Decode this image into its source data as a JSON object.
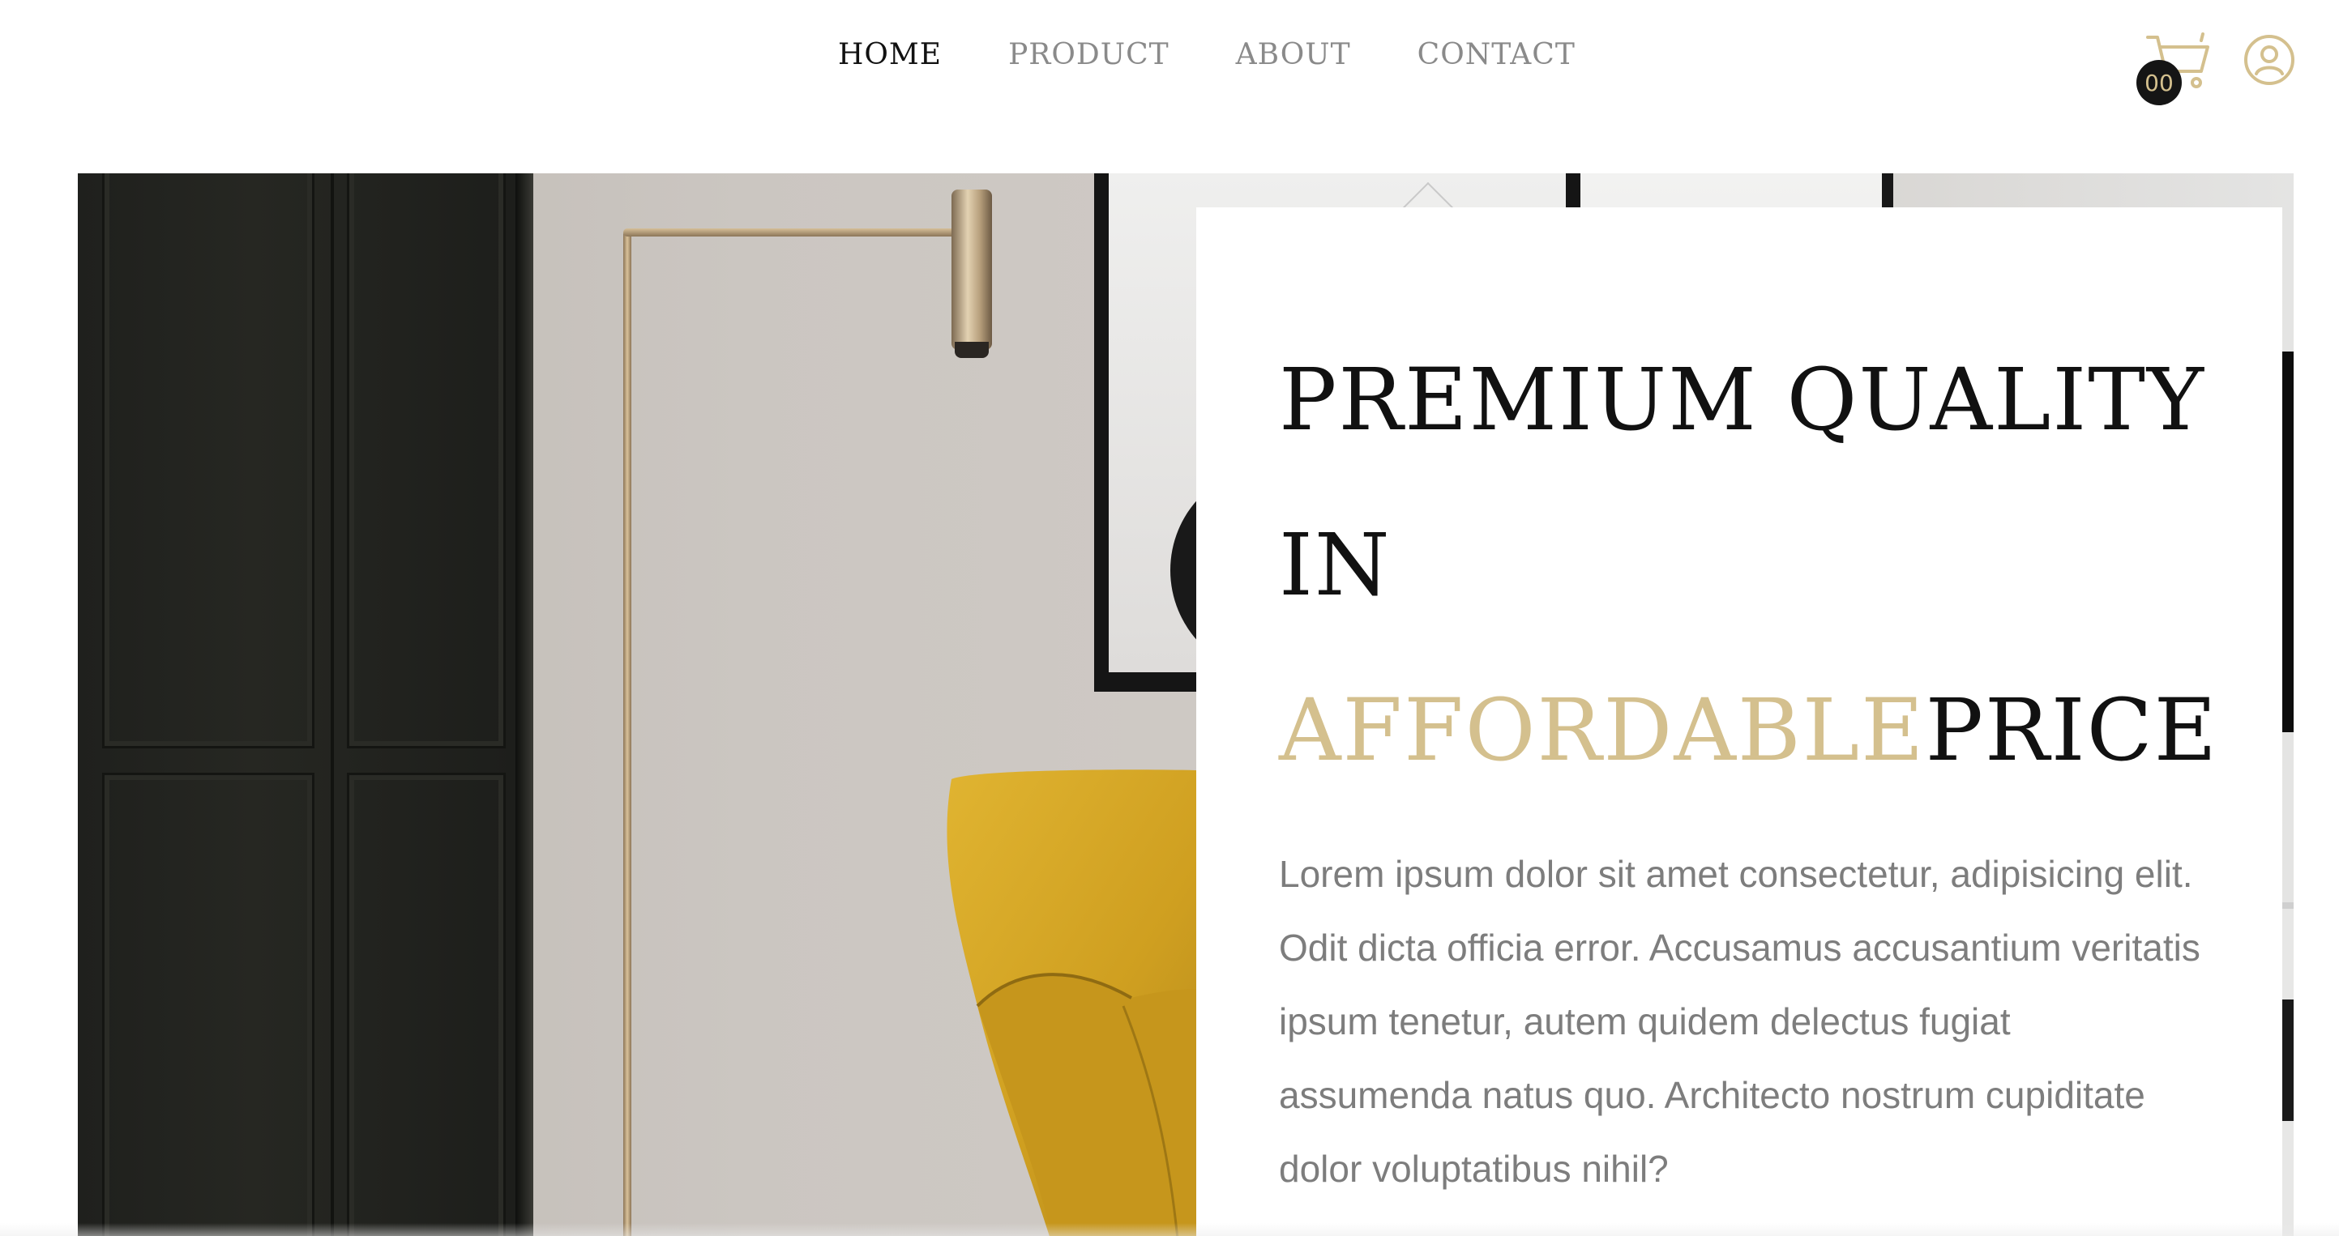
{
  "nav": {
    "items": [
      {
        "label": "HOME",
        "active": true
      },
      {
        "label": "PRODUCT",
        "active": false
      },
      {
        "label": "ABOUT",
        "active": false
      },
      {
        "label": "CONTACT",
        "active": false
      }
    ]
  },
  "header": {
    "cart_count": "00",
    "cart_icon": "shopping-cart-icon",
    "account_icon": "user-circle-icon"
  },
  "hero": {
    "headline_line1": "PREMIUM QUALITY",
    "headline_line2": "IN",
    "headline_accent": "AFFORDABLE",
    "headline_rest": "PRICE",
    "body": "Lorem ipsum dolor sit amet consectetur, adipisicing elit. Odit dicta officia error. Accusamus accusantium veritatis ipsum tenetur, autem quidem delectus fugiat assumenda natus quo. Architecto nostrum cupiditate dolor voluptatibus nihil?"
  },
  "colors": {
    "accent": "#d4c08e",
    "text_dark": "#111111",
    "text_muted": "#7d7d7d",
    "nav_inactive": "#8a8a8a"
  }
}
